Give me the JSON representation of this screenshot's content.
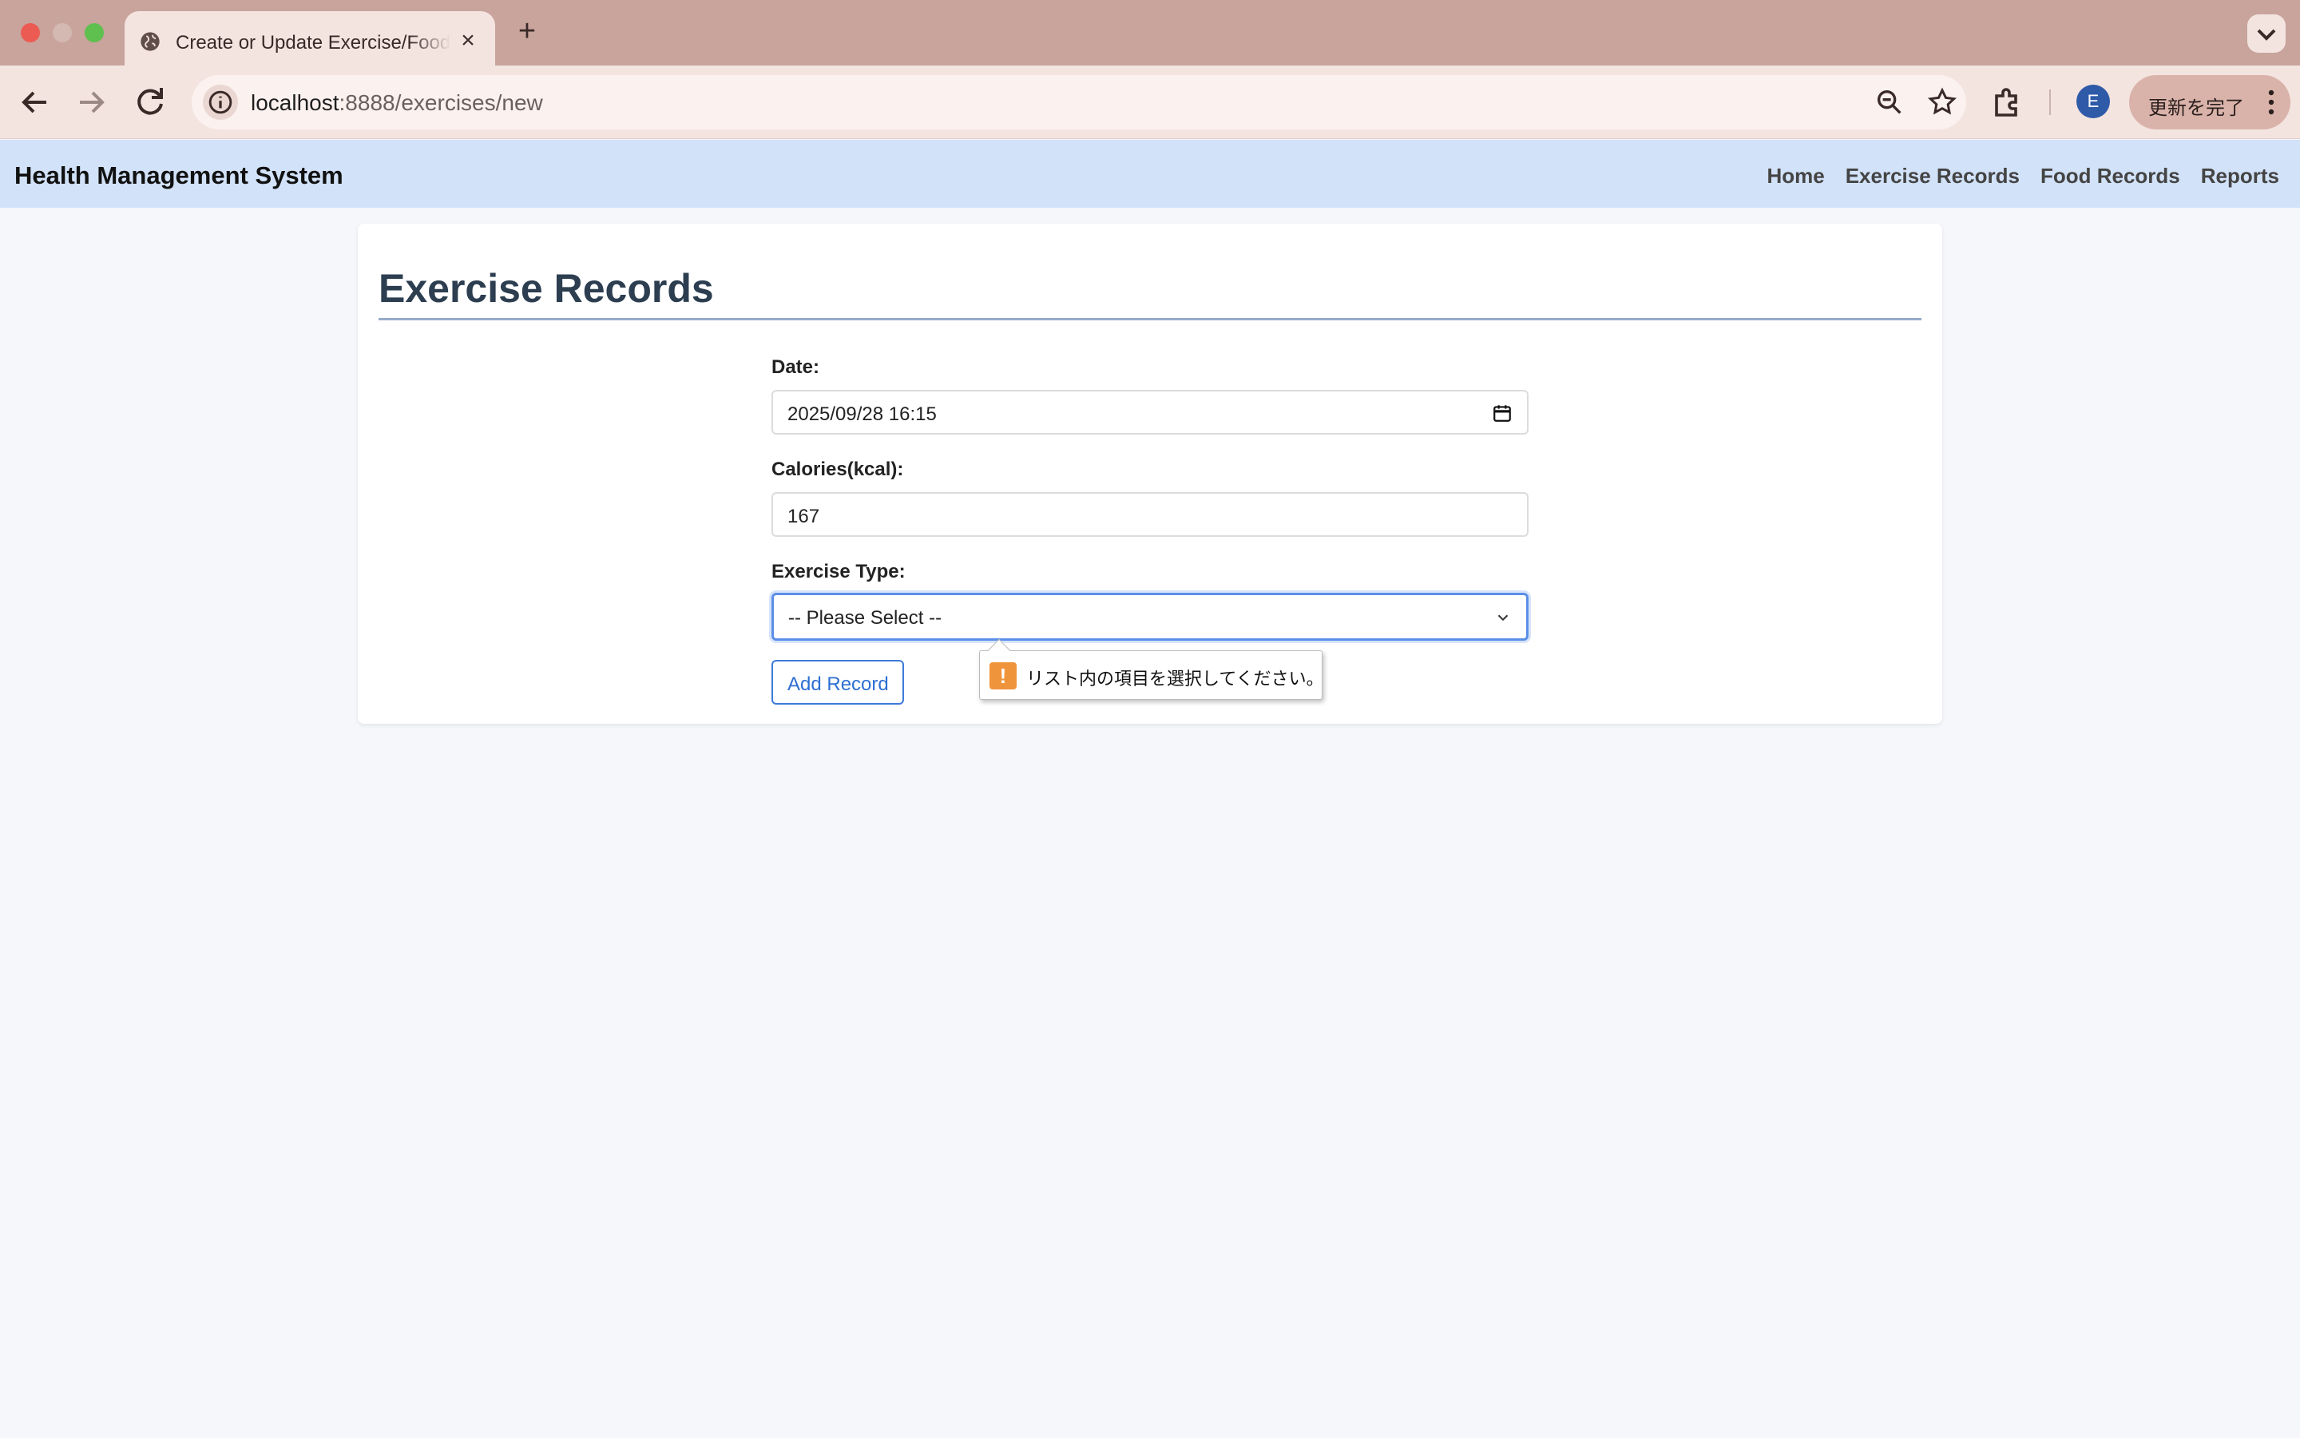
{
  "browser": {
    "tab_title": "Create or Update Exercise/Food",
    "url_host": "localhost",
    "url_path": ":8888/exercises/new",
    "profile_initial": "E",
    "update_label": "更新を完了"
  },
  "navbar": {
    "brand": "Health Management System",
    "links": [
      "Home",
      "Exercise Records",
      "Food Records",
      "Reports"
    ]
  },
  "page": {
    "title": "Exercise Records",
    "form": {
      "date_label": "Date:",
      "date_value": "2025/09/28 16:15",
      "calories_label": "Calories(kcal):",
      "calories_value": "167",
      "type_label": "Exercise Type:",
      "type_selected": "-- Please Select --",
      "submit_label": "Add Record"
    },
    "validation_message": "リスト内の項目を選択してください。"
  },
  "colors": {
    "tabbar": "#c8a49c",
    "toolbar": "#f4e4e0",
    "navbar": "#d2e2f8",
    "page_bg": "#f5f7fb",
    "title": "#2c3e50",
    "accent": "#3d7bd9",
    "warning": "#f0943b"
  },
  "icons": [
    "globe-icon",
    "close-icon",
    "plus-icon",
    "chevron-down-icon",
    "back-arrow-icon",
    "forward-arrow-icon",
    "reload-icon",
    "info-icon",
    "zoom-icon",
    "star-icon",
    "extensions-icon",
    "kebab-menu-icon",
    "calendar-icon",
    "warning-icon"
  ]
}
